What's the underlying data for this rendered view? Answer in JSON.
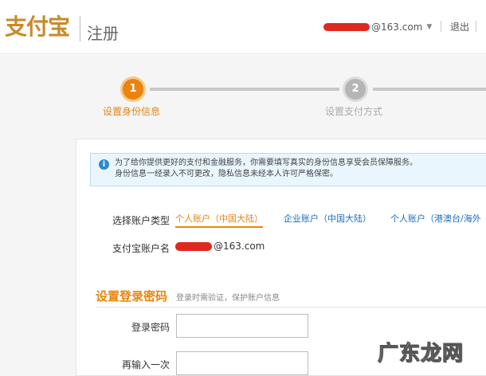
{
  "header": {
    "logo": "支付宝",
    "page_name": "注册",
    "account_suffix": "@163.com",
    "logout": "退出"
  },
  "steps": [
    {
      "number": "1",
      "label": "设置身份信息"
    },
    {
      "number": "2",
      "label": "设置支付方式"
    }
  ],
  "notice": {
    "line1": "为了给你提供更好的支付和金融服务，你需要填写真实的身份信息享受会员保障服务。",
    "line2": "身份信息一经录入不可更改，隐私信息未经本人许可严格保密。"
  },
  "account_type": {
    "label": "选择账户类型",
    "options": [
      "个人账户（中国大陆）",
      "企业账户（中国大陆）",
      "个人账户（港澳台/海外"
    ]
  },
  "account_name": {
    "label": "支付宝账户名",
    "suffix": "@163.com"
  },
  "login_password": {
    "title": "设置登录密码",
    "hint": "登录时需验证，保护账户信息",
    "field_label": "登录密码",
    "confirm_label": "再输入一次"
  },
  "watermark": "广东龙网",
  "colors": {
    "accent": "#e8840f",
    "link": "#1a6fc0",
    "notice_bg": "#eaf6fd"
  }
}
